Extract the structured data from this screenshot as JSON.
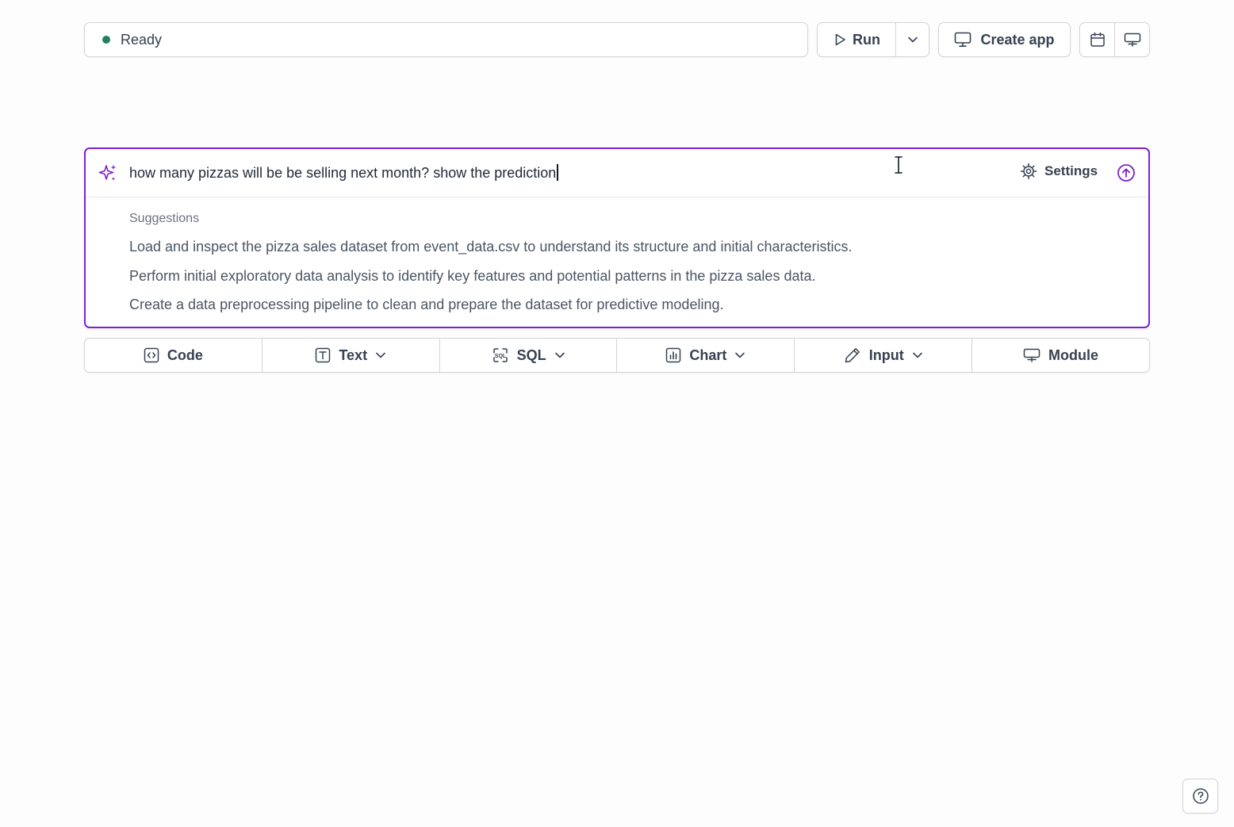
{
  "status": {
    "text": "Ready",
    "dot_color": "#22805d"
  },
  "toolbar": {
    "run_label": "Run",
    "create_app_label": "Create app"
  },
  "prompt": {
    "query": "how many pizzas will be be selling next month? show the prediction",
    "settings_label": "Settings",
    "accent_color": "#7e22ce"
  },
  "suggestions": {
    "title": "Suggestions",
    "items": [
      "Load and inspect the pizza sales dataset from event_data.csv to understand its structure and initial characteristics.",
      "Perform initial exploratory data analysis to identify key features and potential patterns in the pizza sales data.",
      "Create a data preprocessing pipeline to clean and prepare the dataset for predictive modeling."
    ]
  },
  "cell_toolbar": {
    "code": "Code",
    "text": "Text",
    "sql": "SQL",
    "chart": "Chart",
    "input": "Input",
    "module": "Module"
  }
}
